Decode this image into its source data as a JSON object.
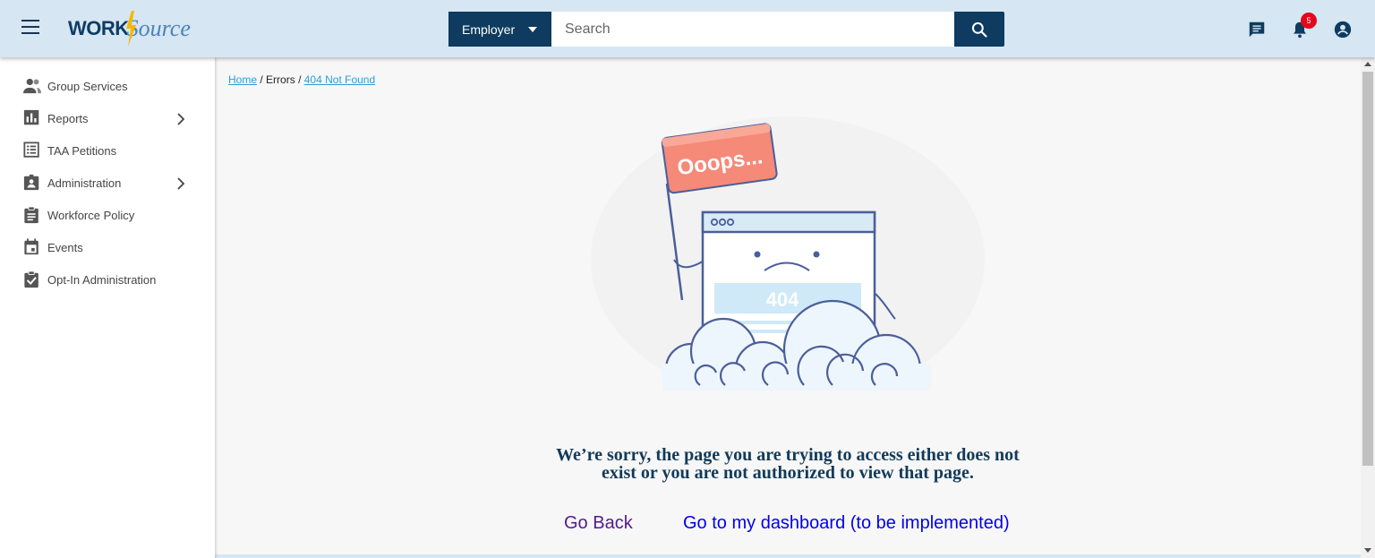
{
  "header": {
    "logo_part1": "WORK",
    "logo_part2": "Source",
    "select_value": "Employer",
    "search_placeholder": "Search",
    "notification_count": "5",
    "icons": [
      "menu-icon",
      "search-icon",
      "chat-icon",
      "bell-icon",
      "account-icon"
    ]
  },
  "sidebar": {
    "items": [
      {
        "label": "Group Services",
        "icon": "group-icon",
        "has_children": false
      },
      {
        "label": "Reports",
        "icon": "bar-chart-icon",
        "has_children": true
      },
      {
        "label": "TAA Petitions",
        "icon": "list-icon",
        "has_children": false
      },
      {
        "label": "Administration",
        "icon": "admin-badge-icon",
        "has_children": true
      },
      {
        "label": "Workforce Policy",
        "icon": "clipboard-icon",
        "has_children": false
      },
      {
        "label": "Events",
        "icon": "calendar-icon",
        "has_children": false
      },
      {
        "label": "Opt-In Administration",
        "icon": "clipboard-check-icon",
        "has_children": false
      }
    ]
  },
  "breadcrumb": {
    "home": "Home",
    "sep": "/",
    "errors": "Errors",
    "current": "404 Not Found"
  },
  "illustration": {
    "flag_text": "Ooops...",
    "code": "404"
  },
  "error": {
    "message_line1": "We’re sorry, the page you are trying to access either does not",
    "message_line2": "exist or you are not authorized to view that page.",
    "go_back": "Go Back",
    "go_dashboard": "Go to my dashboard (to be implemented)"
  },
  "colors": {
    "header_bg": "#d6e6f2",
    "primary_dark": "#0e3b5f",
    "link_blue": "#2a9fd6",
    "badge_red": "#e3081c",
    "flag_salmon": "#f58a79"
  }
}
